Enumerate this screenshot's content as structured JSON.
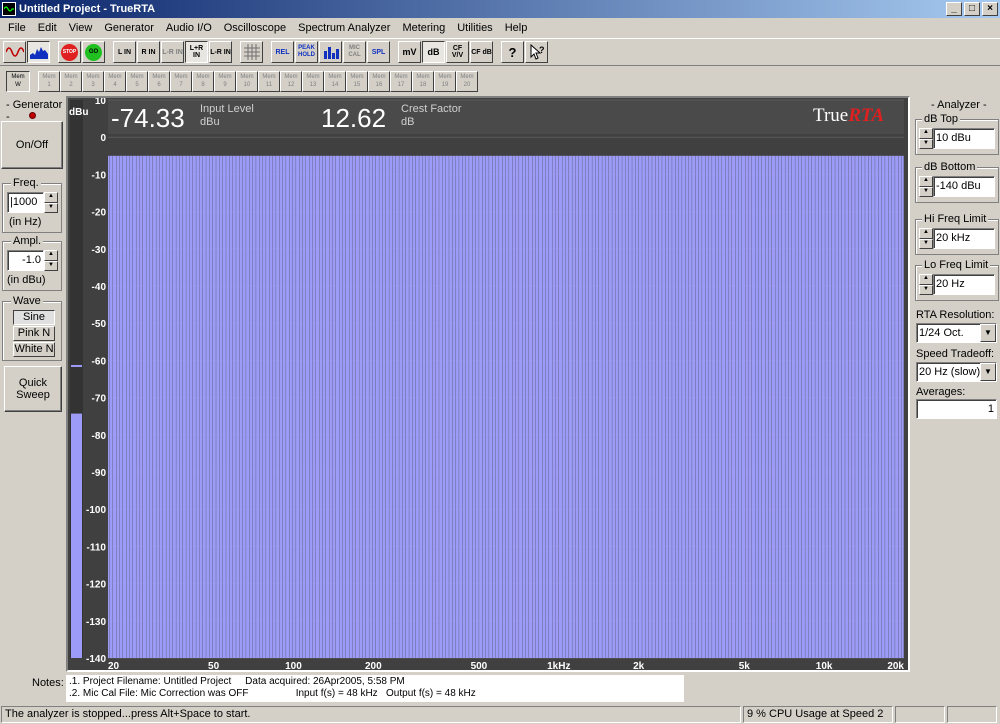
{
  "window": {
    "title": "Untitled Project - TrueRTA",
    "min": "_",
    "max": "□",
    "close": "×"
  },
  "menu": [
    "File",
    "Edit",
    "View",
    "Generator",
    "Audio I/O",
    "Oscilloscope",
    "Spectrum Analyzer",
    "Metering",
    "Utilities",
    "Help"
  ],
  "toolbar": [
    "L\nIN",
    "R\nIN",
    "L-R\nIN",
    "L+R\nIN",
    "L-R\nIN",
    "REL",
    "PEAK\nHOLD",
    "MIC\nCAL",
    "SPL",
    "mV",
    "dB",
    "CF\nV/V",
    "CF\ndB",
    "?"
  ],
  "toolbar_stop": "STOP",
  "toolbar_go": "GO",
  "memory": {
    "current": "Mem\nW",
    "slots": [
      "Mem\n1",
      "Mem\n2",
      "Mem\n3",
      "Mem\n4",
      "Mem\n5",
      "Mem\n6",
      "Mem\n7",
      "Mem\n8",
      "Mem\n9",
      "Mem\n10",
      "Mem\n11",
      "Mem\n12",
      "Mem\n13",
      "Mem\n14",
      "Mem\n15",
      "Mem\n16",
      "Mem\n17",
      "Mem\n18",
      "Mem\n19",
      "Mem\n20"
    ]
  },
  "generator": {
    "title": "Generator",
    "onoff": "On/Off",
    "freq_label": "Freq.",
    "freq_value": "|1000",
    "freq_unit": "(in Hz)",
    "ampl_label": "Ampl.",
    "ampl_value": "-1.0",
    "ampl_unit": "(in dBu)",
    "wave_label": "Wave",
    "waves": [
      "Sine",
      "Pink N",
      "White N"
    ],
    "quick_sweep": "Quick\nSweep"
  },
  "display": {
    "unit": "dBu",
    "input_level_value": "-74.33",
    "input_level_label": "Input Level",
    "input_level_unit": "dBu",
    "crest_value": "12.62",
    "crest_label": "Crest Factor",
    "crest_unit": "dB",
    "logo_a": "True",
    "logo_b": "RTA"
  },
  "chart_data": {
    "type": "bar",
    "ylabel": "dBu",
    "ylim": [
      -140,
      10
    ],
    "y_ticks": [
      "10",
      "0",
      "-10",
      "-20",
      "-30",
      "-40",
      "-50",
      "-60",
      "-70",
      "-80",
      "-90",
      "-100",
      "-110",
      "-120",
      "-130",
      "-140"
    ],
    "x_ticks": [
      "20",
      "50",
      "100",
      "200",
      "500",
      "1kHz",
      "2k",
      "5k",
      "10k",
      "20k"
    ],
    "x_scale": "log",
    "xlim": [
      20,
      20000
    ],
    "bands_per_octave": 24,
    "band_level": -5,
    "input_meter_level": -74.3,
    "input_meter_peak": -61.5,
    "bar_color": "#9c9cf8",
    "background": "#404040"
  },
  "analyzer": {
    "title": "Analyzer",
    "db_top_label": "dB Top",
    "db_top": "10 dBu",
    "db_bottom_label": "dB Bottom",
    "db_bottom": "-140 dBu",
    "hi_label": "Hi Freq Limit",
    "hi": "20 kHz",
    "lo_label": "Lo Freq Limit",
    "lo": "20 Hz",
    "res_label": "RTA Resolution:",
    "res": "1/24 Oct.",
    "speed_label": "Speed Tradeoff:",
    "speed": "20 Hz (slow)",
    "avg_label": "Averages:",
    "avg": "1"
  },
  "notes": {
    "label": "Notes:",
    "line1": ".1. Project Filename: Untitled Project     Data acquired: 26Apr2005, 5:58 PM",
    "line2": ".2. Mic Cal File: Mic Correction was OFF                 Input f(s) = 48 kHz   Output f(s) = 48 kHz"
  },
  "status": {
    "message": "The analyzer is stopped...press Alt+Space to start.",
    "cpu": "9 % CPU Usage at Speed 2"
  }
}
